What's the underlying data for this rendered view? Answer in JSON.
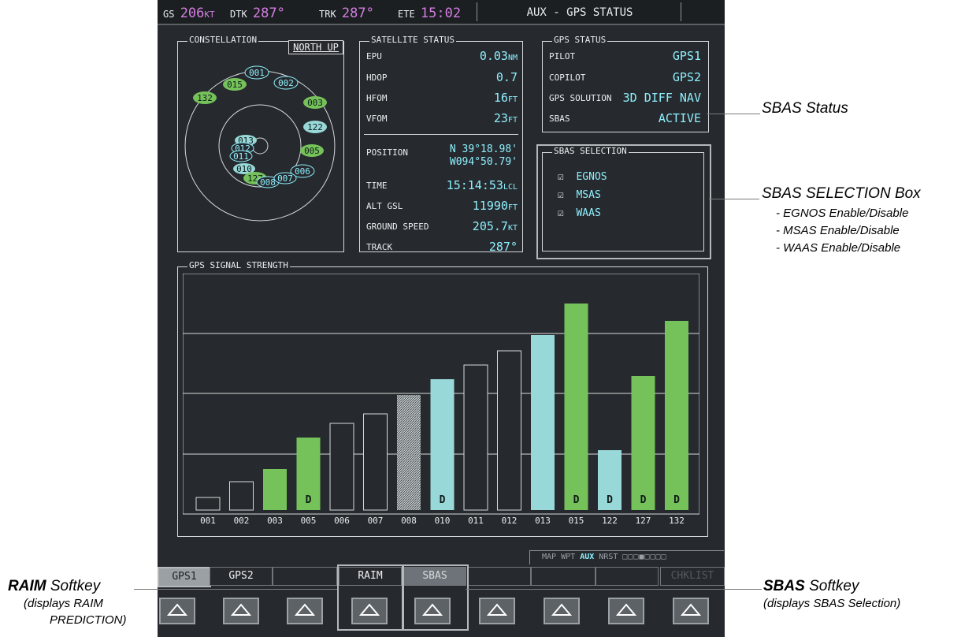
{
  "topbar": {
    "gs_label": "GS",
    "gs_value": "206",
    "gs_unit": "KT",
    "dtk_label": "DTK",
    "dtk_value": "287°",
    "trk_label": "TRK",
    "trk_value": "287°",
    "ete_label": "ETE",
    "ete_value": "15:02",
    "page_title": "AUX - GPS STATUS"
  },
  "constellation": {
    "title": "CONSTELLATION",
    "orientation": "NORTH UP",
    "sats": [
      "001",
      "002",
      "015",
      "132",
      "003",
      "122",
      "013",
      "012",
      "011",
      "005",
      "010",
      "006",
      "127",
      "008",
      "007"
    ]
  },
  "satellite_status": {
    "title": "SATELLITE STATUS",
    "rows": [
      {
        "label": "EPU",
        "value": "0.03",
        "unit": "NM"
      },
      {
        "label": "HDOP",
        "value": "0.7",
        "unit": ""
      },
      {
        "label": "HFOM",
        "value": "16",
        "unit": "FT"
      },
      {
        "label": "VFOM",
        "value": "23",
        "unit": "FT"
      }
    ],
    "position_label": "POSITION",
    "position_lat": "N 39°18.98'",
    "position_lon": "W094°50.79'",
    "rows2": [
      {
        "label": "TIME",
        "value": "15:14:53",
        "unit": "LCL"
      },
      {
        "label": "ALT GSL",
        "value": "11990",
        "unit": "FT"
      },
      {
        "label": "GROUND SPEED",
        "value": "205.7",
        "unit": "KT"
      },
      {
        "label": "TRACK",
        "value": "287°",
        "unit": ""
      }
    ]
  },
  "gps_status": {
    "title": "GPS STATUS",
    "rows": [
      {
        "label": "PILOT",
        "value": "GPS1"
      },
      {
        "label": "COPILOT",
        "value": "GPS2"
      },
      {
        "label": "GPS SOLUTION",
        "value": "3D DIFF NAV"
      },
      {
        "label": "SBAS",
        "value": "ACTIVE"
      }
    ]
  },
  "sbas_selection": {
    "title": "SBAS SELECTION",
    "items": [
      {
        "label": "EGNOS",
        "checked": true
      },
      {
        "label": "MSAS",
        "checked": true
      },
      {
        "label": "WAAS",
        "checked": true
      }
    ]
  },
  "signal": {
    "title": "GPS SIGNAL STRENGTH",
    "d_label": "D"
  },
  "chart_data": {
    "type": "bar",
    "categories": [
      "001",
      "002",
      "003",
      "005",
      "006",
      "007",
      "008",
      "010",
      "011",
      "012",
      "013",
      "015",
      "122",
      "127",
      "132"
    ],
    "values": [
      0.08,
      0.18,
      0.26,
      0.46,
      0.55,
      0.61,
      0.73,
      0.83,
      0.92,
      1.01,
      1.11,
      1.31,
      0.38,
      0.85,
      1.2
    ],
    "status": [
      "outline",
      "outline",
      "green",
      "green",
      "outline",
      "outline",
      "hatched",
      "cyan",
      "outline",
      "outline",
      "cyan",
      "green",
      "cyan",
      "green",
      "green"
    ],
    "diff": [
      false,
      false,
      false,
      true,
      false,
      false,
      false,
      true,
      false,
      false,
      false,
      true,
      true,
      true,
      true
    ],
    "ylim": [
      0,
      1.5
    ],
    "colors": {
      "green": "#76c25a",
      "cyan": "#98d8d8",
      "outline": "#262a2e",
      "hatched": "#a9b0b3"
    }
  },
  "page_group": {
    "items": [
      "MAP",
      "WPT",
      "AUX",
      "NRST"
    ],
    "active": "AUX",
    "pages": 8,
    "current_page": 4
  },
  "softkeys": [
    "GPS1",
    "GPS2",
    "",
    "",
    "RAIM",
    "SBAS",
    "",
    "",
    "",
    "CHKLIST"
  ],
  "annotations": {
    "sbas_status": "SBAS Status",
    "sbas_box_title": "SBAS SELECTION Box",
    "sbas_box_lines": [
      "- EGNOS Enable/Disable",
      "- MSAS Enable/Disable",
      "- WAAS Enable/Disable"
    ],
    "raim_title": "RAIM",
    "raim_title_rest": " Softkey",
    "raim_desc": "(displays RAIM",
    "raim_desc2": "PREDICTION)",
    "sbas_title": "SBAS",
    "sbas_title_rest": " Softkey",
    "sbas_desc": "(displays SBAS Selection)"
  }
}
